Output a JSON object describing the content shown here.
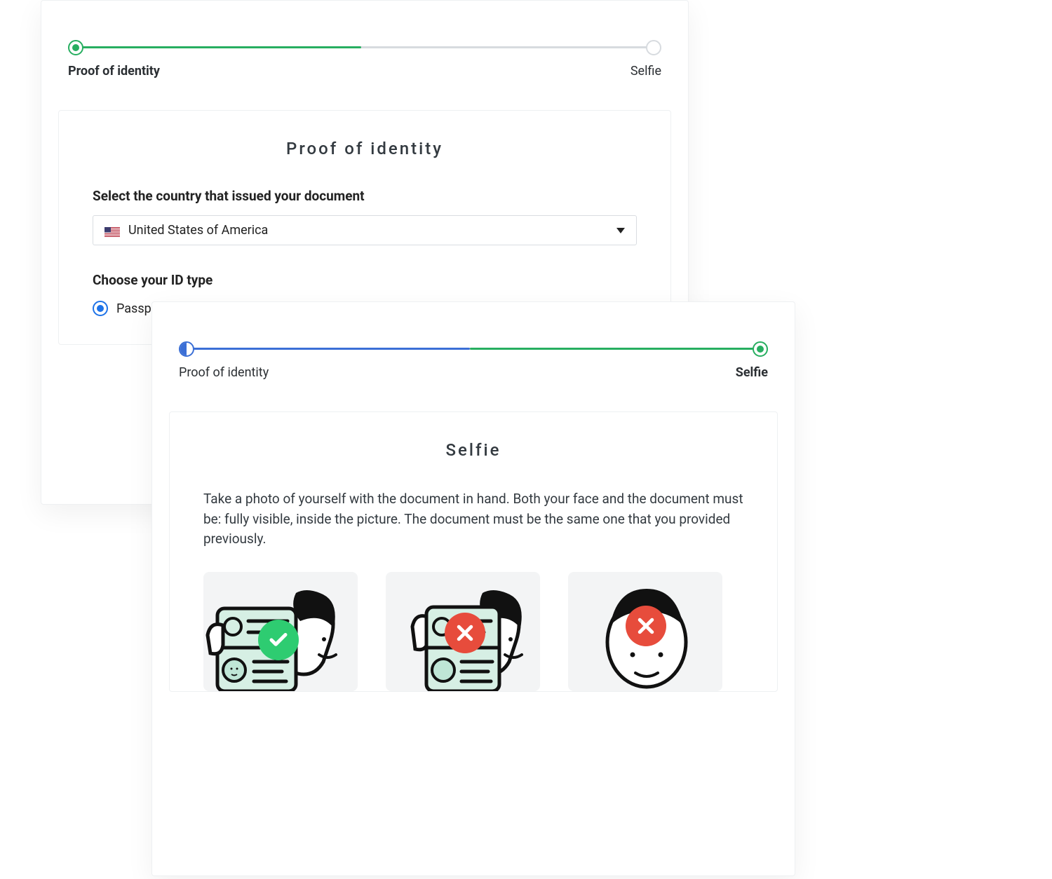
{
  "steps": {
    "proof_of_identity": "Proof of identity",
    "selfie": "Selfie"
  },
  "panel1": {
    "title": "Proof of identity",
    "country_label": "Select the country that issued your document",
    "country_value": "United States of America",
    "id_type_label": "Choose your ID type",
    "radio_passport": "Passport"
  },
  "panel2": {
    "title": "Selfie",
    "description": "Take a photo of yourself with the document in hand. Both your face and the document must be: fully visible, inside the picture. The document must be the same one that you provided previously."
  },
  "colors": {
    "green": "#27ae60",
    "blue": "#3b6fd6",
    "red": "#e74c3c"
  }
}
